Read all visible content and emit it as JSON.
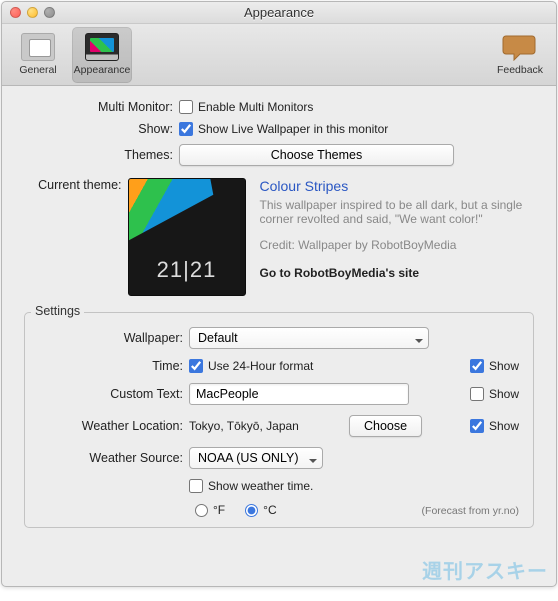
{
  "window": {
    "title": "Appearance"
  },
  "toolbar": {
    "general": "General",
    "appearance": "Appearance",
    "feedback": "Feedback"
  },
  "form": {
    "multiMonitorLabel": "Multi Monitor:",
    "enableMultiMonitors": "Enable Multi Monitors",
    "showLabel": "Show:",
    "showLiveWallpaper": "Show Live Wallpaper in this monitor",
    "themesLabel": "Themes:",
    "chooseThemes": "Choose Themes",
    "currentThemeLabel": "Current theme:"
  },
  "theme": {
    "name": "Colour Stripes",
    "desc": "This wallpaper inspired to be all dark, but a single corner revolted and said, \"We want color!\"",
    "credit": "Credit: Wallpaper by RobotBoyMedia",
    "link": "Go to RobotBoyMedia's site",
    "previewTime": "21|21"
  },
  "settings": {
    "legend": "Settings",
    "wallpaperLabel": "Wallpaper:",
    "wallpaperValue": "Default",
    "timeLabel": "Time:",
    "use24h": "Use 24-Hour format",
    "showLabel": "Show",
    "customTextLabel": "Custom Text:",
    "customTextValue": "MacPeople",
    "weatherLocLabel": "Weather Location:",
    "weatherLocValue": "Tokyo, Tōkyō, Japan",
    "chooseBtn": "Choose",
    "weatherSrcLabel": "Weather Source:",
    "weatherSrcValue": "NOAA (US ONLY)",
    "showWeatherTime": "Show weather time.",
    "unitF": "°F",
    "unitC": "°C",
    "forecast": "(Forecast from yr.no)"
  },
  "watermark": "週刊アスキー"
}
